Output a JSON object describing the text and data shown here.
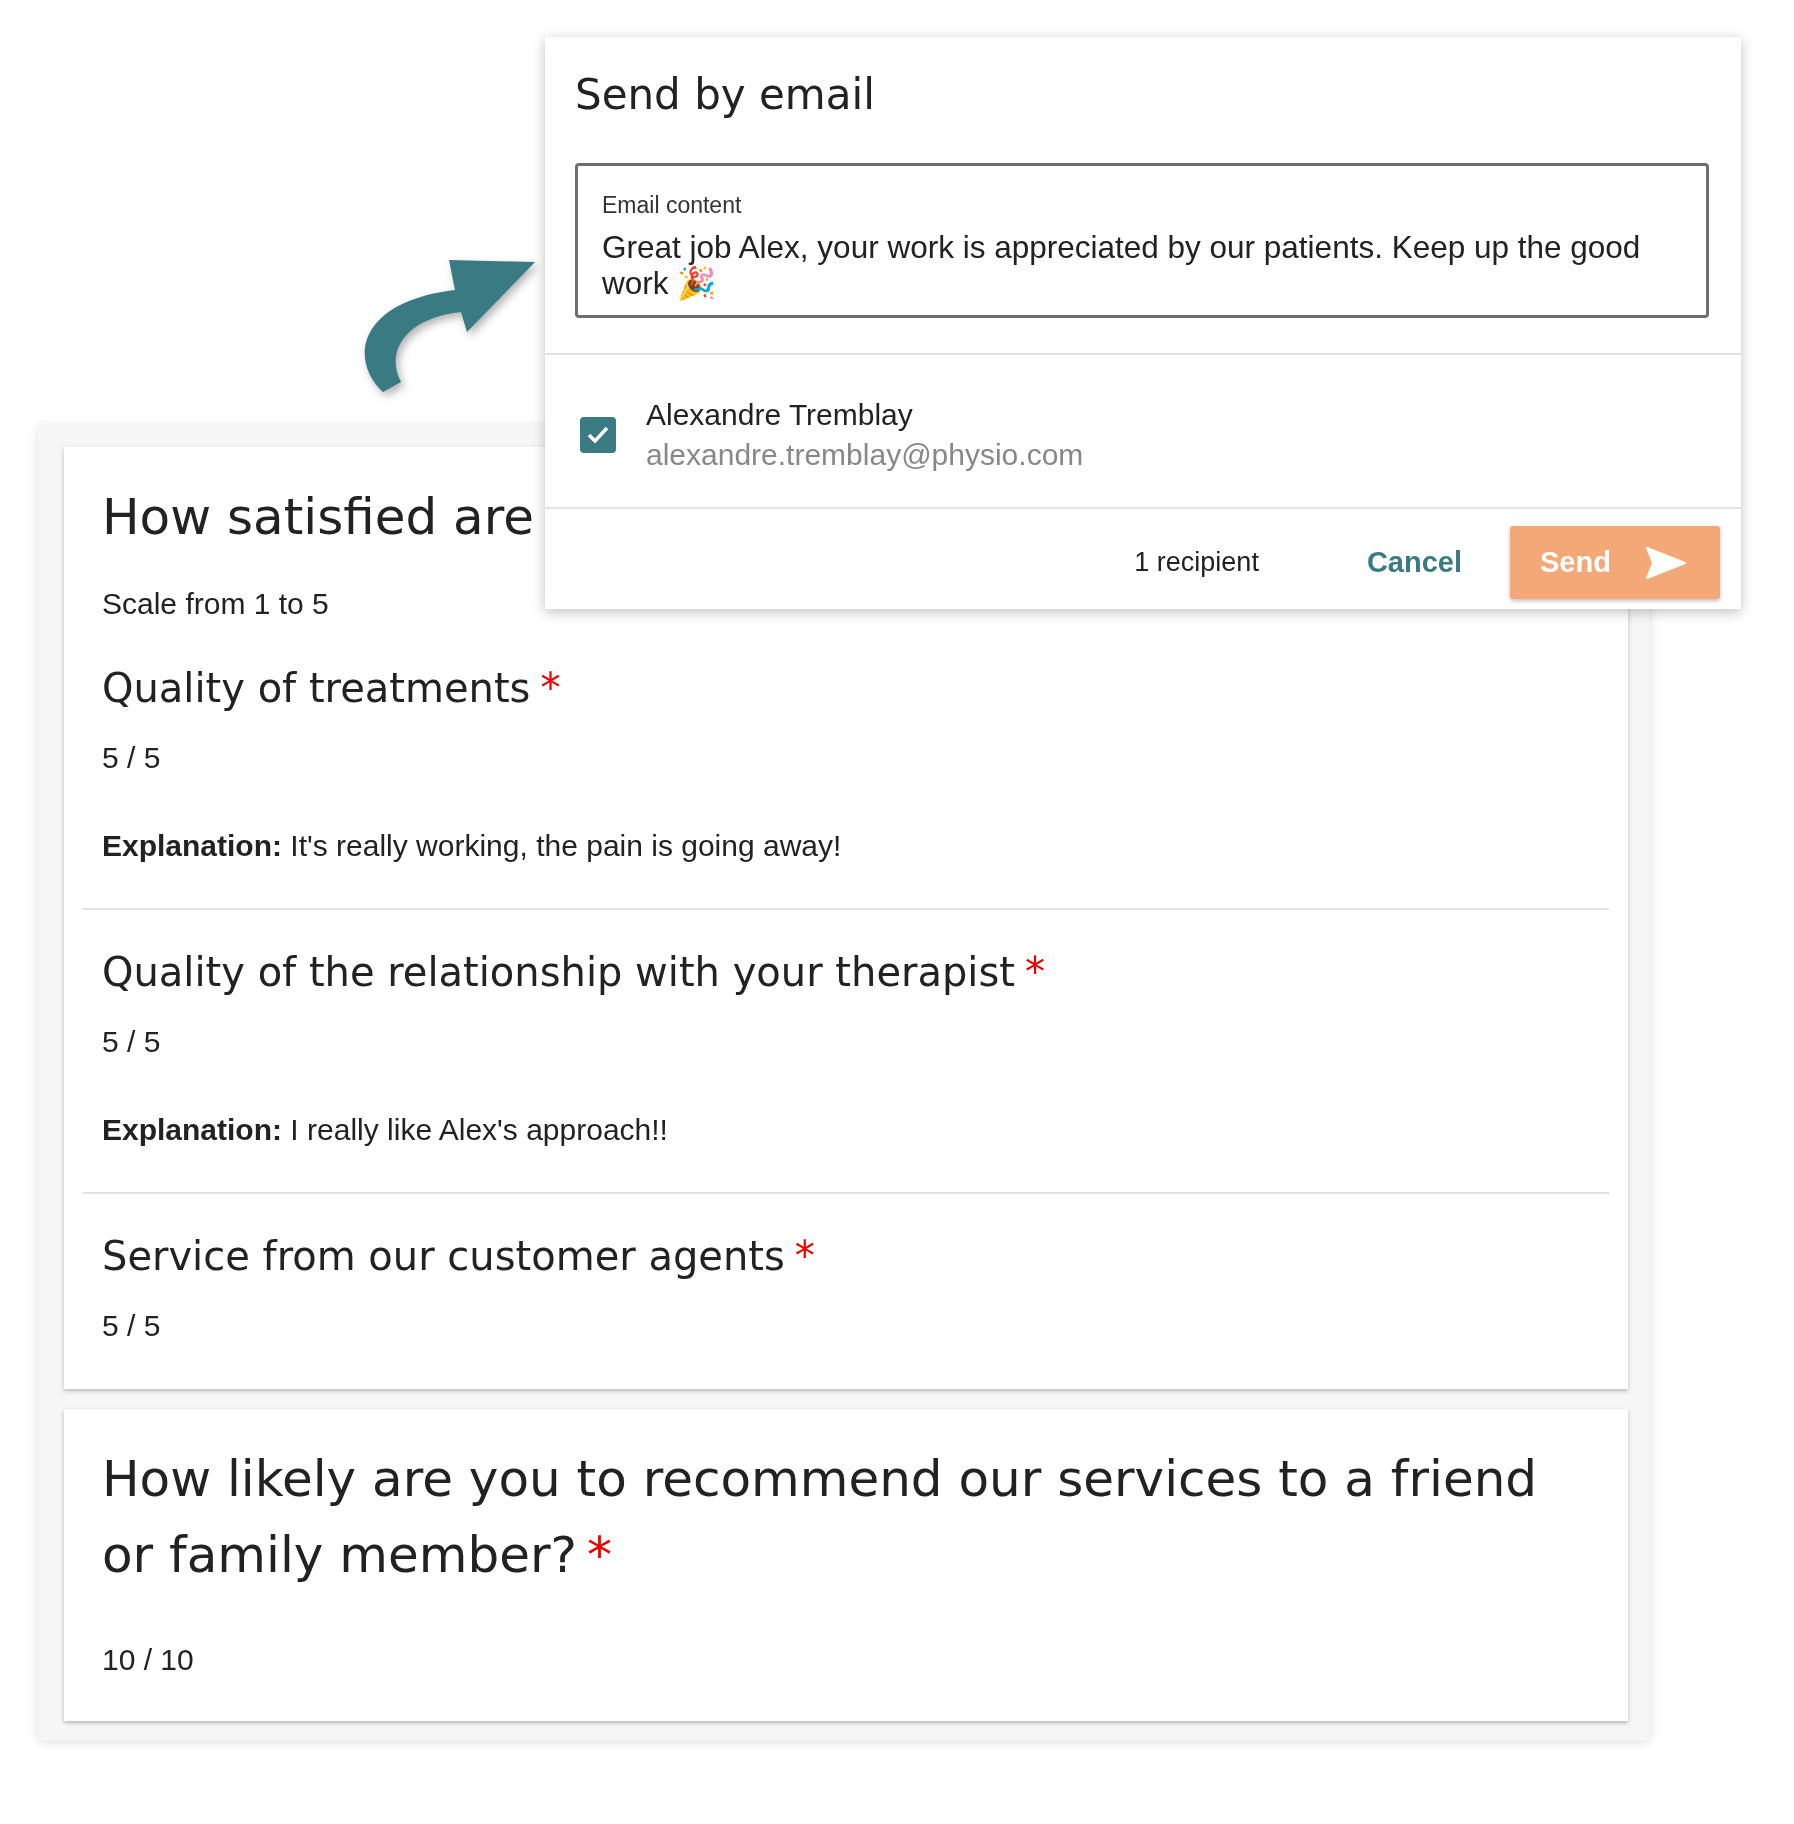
{
  "survey_card": {
    "title": "How satisfied are",
    "subtitle": "Scale from 1 to 5",
    "questions": [
      {
        "title": "Quality of treatments",
        "required_mark": "*",
        "score": "5 / 5",
        "explanation": "**Explanation:** It's really working, the pain is going away!"
      },
      {
        "title": "Quality of the relationship with your therapist",
        "required_mark": "*",
        "score": "5 / 5",
        "explanation": "**Explanation:** I really like Alex's approach!!"
      },
      {
        "title": "Service from our customer agents",
        "required_mark": "*",
        "score": "5 / 5"
      }
    ]
  },
  "recommend_card": {
    "title": "How likely are you to recommend our services to a friend or family member?",
    "required_mark": "*",
    "score": "10 / 10"
  },
  "dialog": {
    "title": "Send by email",
    "field": {
      "label": "Email content",
      "value": "Great job Alex, your work is appreciated by our patients. Keep up the good work 🎉"
    },
    "recipients": [
      {
        "name": "Alexandre Tremblay",
        "email": "alexandre.tremblay@physio.com",
        "checked": true
      }
    ],
    "recipient_count": "1 recipient",
    "cancel": "Cancel",
    "send": "Send"
  }
}
